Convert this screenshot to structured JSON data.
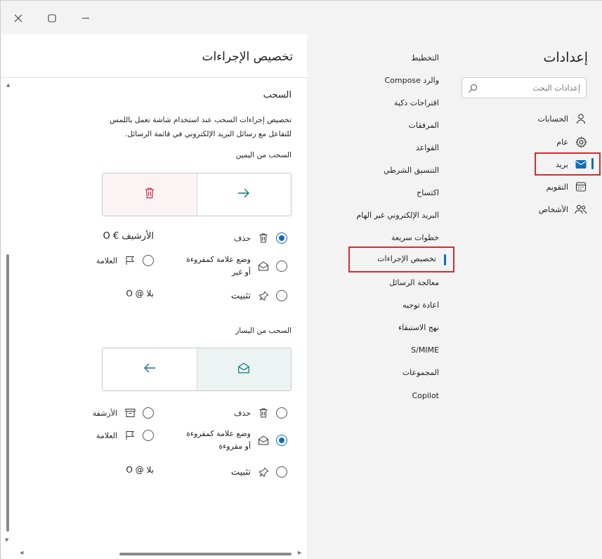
{
  "window": {
    "close_icon": "close-icon",
    "maximize_icon": "maximize-icon",
    "minimize_icon": "minimize-icon"
  },
  "nav": {
    "title": "إعدادات",
    "search_placeholder": "إعدادات البحث",
    "items": [
      {
        "label": "الحسابات",
        "icon": "person-icon"
      },
      {
        "label": "عام",
        "icon": "gear-icon"
      },
      {
        "label": "بريد",
        "icon": "mail-icon"
      },
      {
        "label": "التقويم",
        "icon": "calendar-icon"
      },
      {
        "label": "الأشخاص",
        "icon": "people-icon"
      }
    ]
  },
  "subnav": {
    "items": [
      {
        "label": "التخطيط"
      },
      {
        "label": "Compose والرد"
      },
      {
        "label": "اقتراحات ذكية"
      },
      {
        "label": "المرفقات"
      },
      {
        "label": "القواعد"
      },
      {
        "label": "التنسيق الشرطي"
      },
      {
        "label": "اكتساح"
      },
      {
        "label": "البريد الإلكتروني غير الهام"
      },
      {
        "label": "خطوات سريعة"
      },
      {
        "label": "تخصيص الإجراءات"
      },
      {
        "label": "معالجة الرسائل"
      },
      {
        "label": "اعادة توجيه"
      },
      {
        "label": "نهج الاستبقاء"
      },
      {
        "label": "S/MIME"
      },
      {
        "label": "المجموعات"
      },
      {
        "label": "Copilot"
      }
    ]
  },
  "content": {
    "title": "تخصيص الإجراءات",
    "section_title": "السحب",
    "description": "تخصيص إجراءات السحب عند استخدام شاشة تعمل باللمس للتفاعل مع رسائل البريد الإلكتروني في قائمة الرسائل.",
    "right_swipe": {
      "label": "السحب من اليمين",
      "options": [
        {
          "label": "حذف",
          "icon": "trash-icon",
          "selected": true
        },
        {
          "label": "O € الأرشيف",
          "icon": "",
          "selected": false
        },
        {
          "label": "وضع علامة كمقروءة أو غير",
          "icon": "mail-open-icon",
          "selected": false
        },
        {
          "label": "العلامة",
          "icon": "flag-icon",
          "selected": false
        },
        {
          "label": "تثبيت",
          "icon": "pin-icon",
          "selected": false
        },
        {
          "label": "O @ بلا",
          "icon": "",
          "selected": false
        }
      ]
    },
    "left_swipe": {
      "label": "السحب من اليسار",
      "options": [
        {
          "label": "حذف",
          "icon": "trash-icon",
          "selected": false
        },
        {
          "label": "الأرشفة",
          "icon": "archive-icon",
          "selected": false
        },
        {
          "label": "وضع علامة كمقروءة أو مقروءة",
          "icon": "mail-open-icon",
          "selected": true
        },
        {
          "label": "العلامة",
          "icon": "flag-icon",
          "selected": false
        },
        {
          "label": "تثبيت",
          "icon": "pin-icon",
          "selected": false
        },
        {
          "label": "O @ بلا",
          "icon": "",
          "selected": false
        }
      ]
    }
  },
  "colors": {
    "accent": "#0f6cbd",
    "highlight_box": "#d82b2b",
    "delete_red": "#c4314b",
    "teal": "#0e7a7a"
  }
}
